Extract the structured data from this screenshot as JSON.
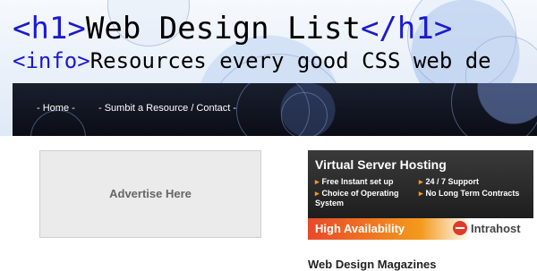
{
  "header": {
    "title_open_tag": "<h1>",
    "title_text": "Web Design List",
    "title_close_tag": "</h1>",
    "info_tag": "<info>",
    "info_text": "Resources every good CSS web de"
  },
  "nav": {
    "items": [
      {
        "label": "- Home -"
      },
      {
        "label": "- Sumbit a Resource / Contact -"
      }
    ]
  },
  "ad": {
    "label": "Advertise Here"
  },
  "banner": {
    "title": "Virtual Server Hosting",
    "features": [
      "Free Instant set up",
      "24 / 7 Support",
      "Choice of Operating System",
      "No Long Term Contracts"
    ],
    "tagline": "High Availability",
    "brand": "Intrahost",
    "colors": {
      "accent": "#f39a1c",
      "brand_red": "#e03a2a"
    }
  },
  "sidebar": {
    "heading": "Web Design Magazines"
  }
}
